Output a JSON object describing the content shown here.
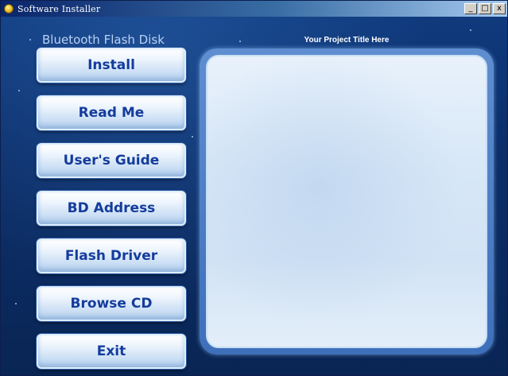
{
  "window": {
    "title": "Software Installer",
    "buttons": {
      "minimize": "_",
      "maximize": "□",
      "close": "x"
    }
  },
  "app": {
    "label": "Bluetooth Flash Disk",
    "project_title": "Your Project Title Here"
  },
  "menu": [
    {
      "label": "Install"
    },
    {
      "label": "Read Me"
    },
    {
      "label": "User's Guide"
    },
    {
      "label": "BD Address"
    },
    {
      "label": "Flash Driver"
    },
    {
      "label": "Browse CD"
    },
    {
      "label": "Exit"
    }
  ],
  "icons": {
    "app": "installer-app-icon"
  },
  "colors": {
    "button_text": "#143c9c",
    "background": "#0c2f6a"
  }
}
